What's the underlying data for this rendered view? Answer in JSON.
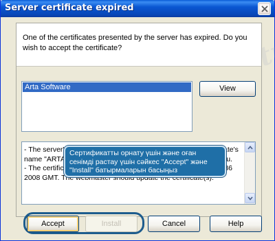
{
  "window": {
    "title": "Server certificate expired"
  },
  "dialog": {
    "prompt": "One of the certificates presented by the server has expired. Do you wish to accept the certificate?",
    "certificates": [
      {
        "name": "Arta Software",
        "selected": true
      }
    ],
    "view_label": "View",
    "details_text": "- The server's name \"192.168.1.18\" does not match the certificate's name \"ARTA.KZ\". Somebody may be trying to eavesdrop on you.\n- The certificate has expired on Thursday, May 01, 2008 15:03:36 2008 GMT. The webmaster should update the certificate(s)."
  },
  "tooltip": {
    "text": "Сертификатты орнату үшін және оған сенімді растау үшін сәйкес \"Accept\" және \"Install\" батырмаларын басыңыз"
  },
  "buttons": {
    "accept": "Accept",
    "install": "Install",
    "cancel": "Cancel",
    "help": "Help"
  },
  "watermark": {
    "text": "Stud.kz - Stud.kz"
  },
  "colors": {
    "titlebar": "#0a57d2",
    "selection": "#316ac5",
    "tooltip_bg": "#1f6fa7",
    "dialog_bg": "#ece9d8"
  }
}
